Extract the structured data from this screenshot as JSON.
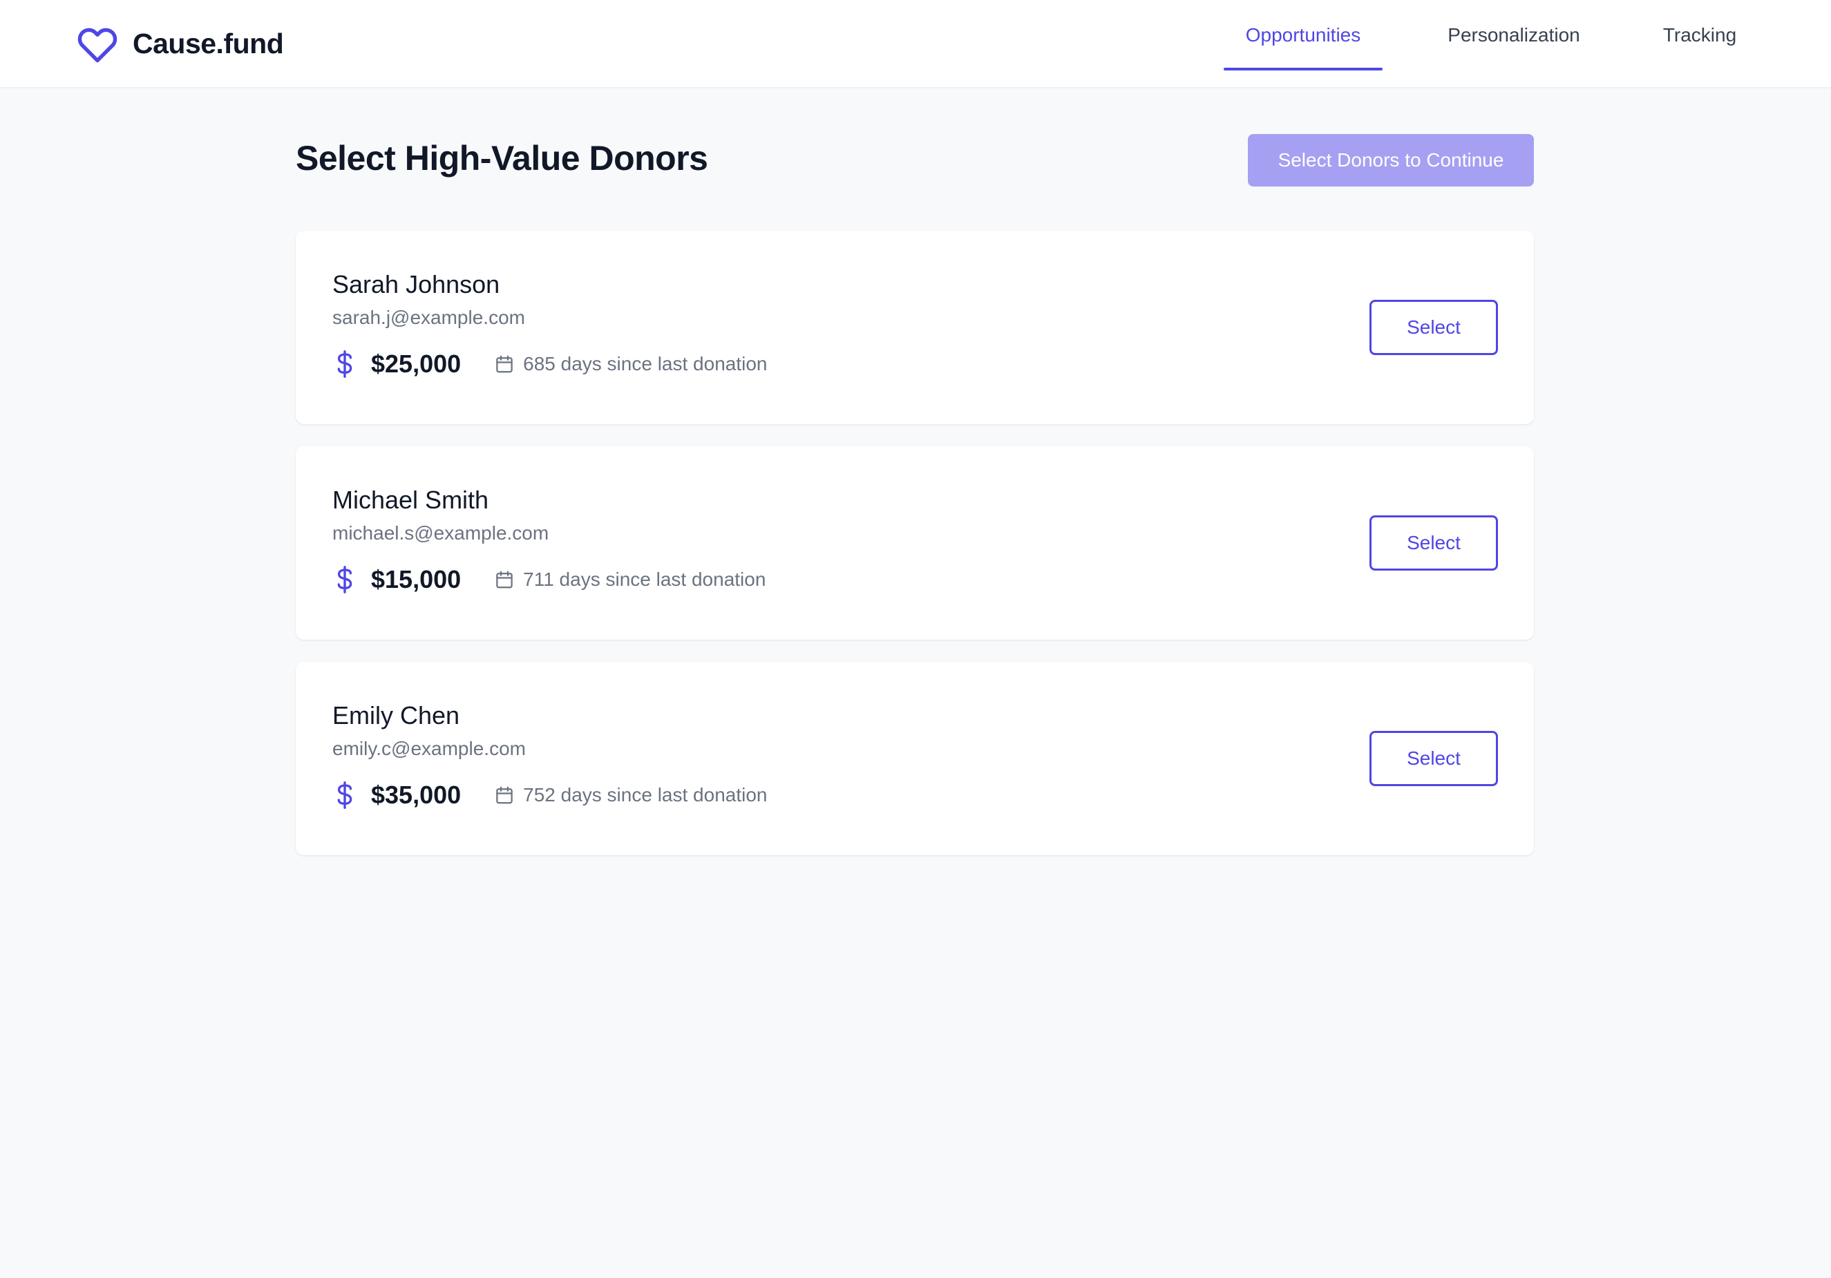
{
  "header": {
    "brand_name": "Cause.fund",
    "brand_icon": "heart-icon",
    "accent_color": "#4f46e5",
    "nav": [
      {
        "label": "Opportunities",
        "active": true
      },
      {
        "label": "Personalization",
        "active": false
      },
      {
        "label": "Tracking",
        "active": false
      }
    ]
  },
  "main": {
    "title": "Select High-Value Donors",
    "continue_label": "Select Donors to Continue",
    "continue_enabled": false,
    "donors": [
      {
        "name": "Sarah Johnson",
        "email": "sarah.j@example.com",
        "amount": "$25,000",
        "days": "685 days since last donation",
        "select_label": "Select"
      },
      {
        "name": "Michael Smith",
        "email": "michael.s@example.com",
        "amount": "$15,000",
        "days": "711 days since last donation",
        "select_label": "Select"
      },
      {
        "name": "Emily Chen",
        "email": "emily.c@example.com",
        "amount": "$35,000",
        "days": "752 days since last donation",
        "select_label": "Select"
      }
    ],
    "icons": {
      "amount": "dollar-icon",
      "recency": "calendar-icon"
    }
  }
}
